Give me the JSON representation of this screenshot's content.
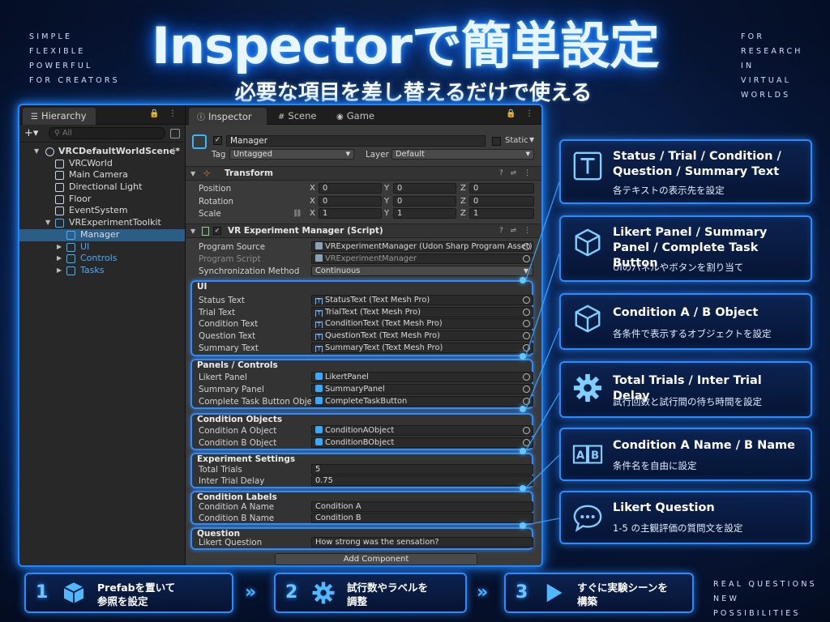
{
  "header": {
    "title": "Inspectorで簡単設定",
    "subtitle": "必要な項目を差し替えるだけで使える",
    "tagline_left": [
      "SIMPLE",
      "FLEXIBLE",
      "POWERFUL",
      "FOR CREATORS"
    ],
    "tagline_right": [
      "FOR",
      "RESEARCH",
      "IN",
      "VIRTUAL",
      "WORLDS"
    ],
    "tagline_bottom": [
      "REAL QUESTIONS",
      "NEW POSSIBILITIES"
    ]
  },
  "hierarchy": {
    "tab": "Hierarchy",
    "search_placeholder": "All",
    "items": [
      {
        "label": "VRCDefaultWorldScene*",
        "icon": "scene-icon"
      },
      {
        "label": "VRCWorld",
        "icon": "cube-icon"
      },
      {
        "label": "Main Camera",
        "icon": "cube-icon"
      },
      {
        "label": "Directional Light",
        "icon": "cube-icon"
      },
      {
        "label": "Floor",
        "icon": "cube-icon"
      },
      {
        "label": "EventSystem",
        "icon": "cube-icon"
      },
      {
        "label": "VRExperimentToolkit",
        "icon": "prefab-icon"
      },
      {
        "label": "Manager",
        "icon": "prefab-icon",
        "selected": true
      },
      {
        "label": "UI",
        "icon": "prefab-icon"
      },
      {
        "label": "Controls",
        "icon": "prefab-icon"
      },
      {
        "label": "Tasks",
        "icon": "prefab-icon"
      }
    ]
  },
  "inspector": {
    "tabs": [
      "Inspector",
      "Scene",
      "Game"
    ],
    "object_name": "Manager",
    "static_label": "Static",
    "tag_label": "Tag",
    "tag_value": "Untagged",
    "layer_label": "Layer",
    "layer_value": "Default",
    "transform": {
      "title": "Transform",
      "position_label": "Position",
      "rotation_label": "Rotation",
      "scale_label": "Scale",
      "position": [
        "0",
        "0",
        "0"
      ],
      "rotation": [
        "0",
        "0",
        "0"
      ],
      "scale": [
        "1",
        "1",
        "1"
      ]
    },
    "script": {
      "title": "VR Experiment Manager (Script)",
      "program_source_label": "Program Source",
      "program_source_value": "VRExperimentManager (Udon Sharp Program Asset)",
      "program_script_label": "Program Script",
      "program_script_value": "VRExperimentManager",
      "sync_label": "Synchronization Method",
      "sync_value": "Continuous"
    },
    "groups": {
      "ui": {
        "title": "UI",
        "rows": [
          {
            "label": "Status Text",
            "value": "StatusText (Text Mesh Pro)"
          },
          {
            "label": "Trial Text",
            "value": "TrialText (Text Mesh Pro)"
          },
          {
            "label": "Condition Text",
            "value": "ConditionText (Text Mesh Pro)"
          },
          {
            "label": "Question Text",
            "value": "QuestionText (Text Mesh Pro)"
          },
          {
            "label": "Summary Text",
            "value": "SummaryText (Text Mesh Pro)"
          }
        ]
      },
      "panels": {
        "title": "Panels / Controls",
        "rows": [
          {
            "label": "Likert Panel",
            "value": "LikertPanel"
          },
          {
            "label": "Summary Panel",
            "value": "SummaryPanel"
          },
          {
            "label": "Complete Task Button Object",
            "value": "CompleteTaskButton"
          }
        ]
      },
      "conditions": {
        "title": "Condition Objects",
        "rows": [
          {
            "label": "Condition A Object",
            "value": "ConditionAObject"
          },
          {
            "label": "Condition B Object",
            "value": "ConditionBObject"
          }
        ]
      },
      "experiment": {
        "title": "Experiment Settings",
        "rows": [
          {
            "label": "Total Trials",
            "value": "5"
          },
          {
            "label": "Inter Trial Delay",
            "value": "0.75"
          }
        ]
      },
      "labels": {
        "title": "Condition Labels",
        "rows": [
          {
            "label": "Condition A Name",
            "value": "Condition A"
          },
          {
            "label": "Condition B Name",
            "value": "Condition B"
          }
        ]
      },
      "question": {
        "title": "Question",
        "rows": [
          {
            "label": "Likert Question",
            "value": "How strong was the sensation?"
          }
        ]
      }
    },
    "add_component": "Add Component"
  },
  "callouts": [
    {
      "title": "Status / Trial / Condition / Question / Summary Text",
      "desc": "各テキストの表示先を設定",
      "icon": "text-icon"
    },
    {
      "title": "Likert Panel / Summary Panel / Complete Task Button",
      "desc": "UIのパネルやボタンを割り当て",
      "icon": "cube-icon"
    },
    {
      "title": "Condition A / B Object",
      "desc": "各条件で表示するオブジェクトを設定",
      "icon": "cube-icon"
    },
    {
      "title": "Total Trials / Inter Trial Delay",
      "desc": "試行回数と試行間の待ち時間を設定",
      "icon": "gear-icon"
    },
    {
      "title": "Condition A Name / B Name",
      "desc": "条件名を自由に設定",
      "icon": "ab-icon"
    },
    {
      "title": "Likert Question",
      "desc": "1-5 の主観評価の質問文を設定",
      "icon": "chat-icon"
    }
  ],
  "steps": [
    {
      "num": "1",
      "text": "Prefabを置いて\n参照を設定",
      "icon": "cube-icon"
    },
    {
      "num": "2",
      "text": "試行数やラベルを\n調整",
      "icon": "gear-icon"
    },
    {
      "num": "3",
      "text": "すぐに実験シーンを\n構築",
      "icon": "play-icon"
    }
  ],
  "step_separator": "»",
  "colors": {
    "accent": "#2c8bff",
    "selection": "#2c5d87",
    "panel": "#3a3a3a"
  }
}
